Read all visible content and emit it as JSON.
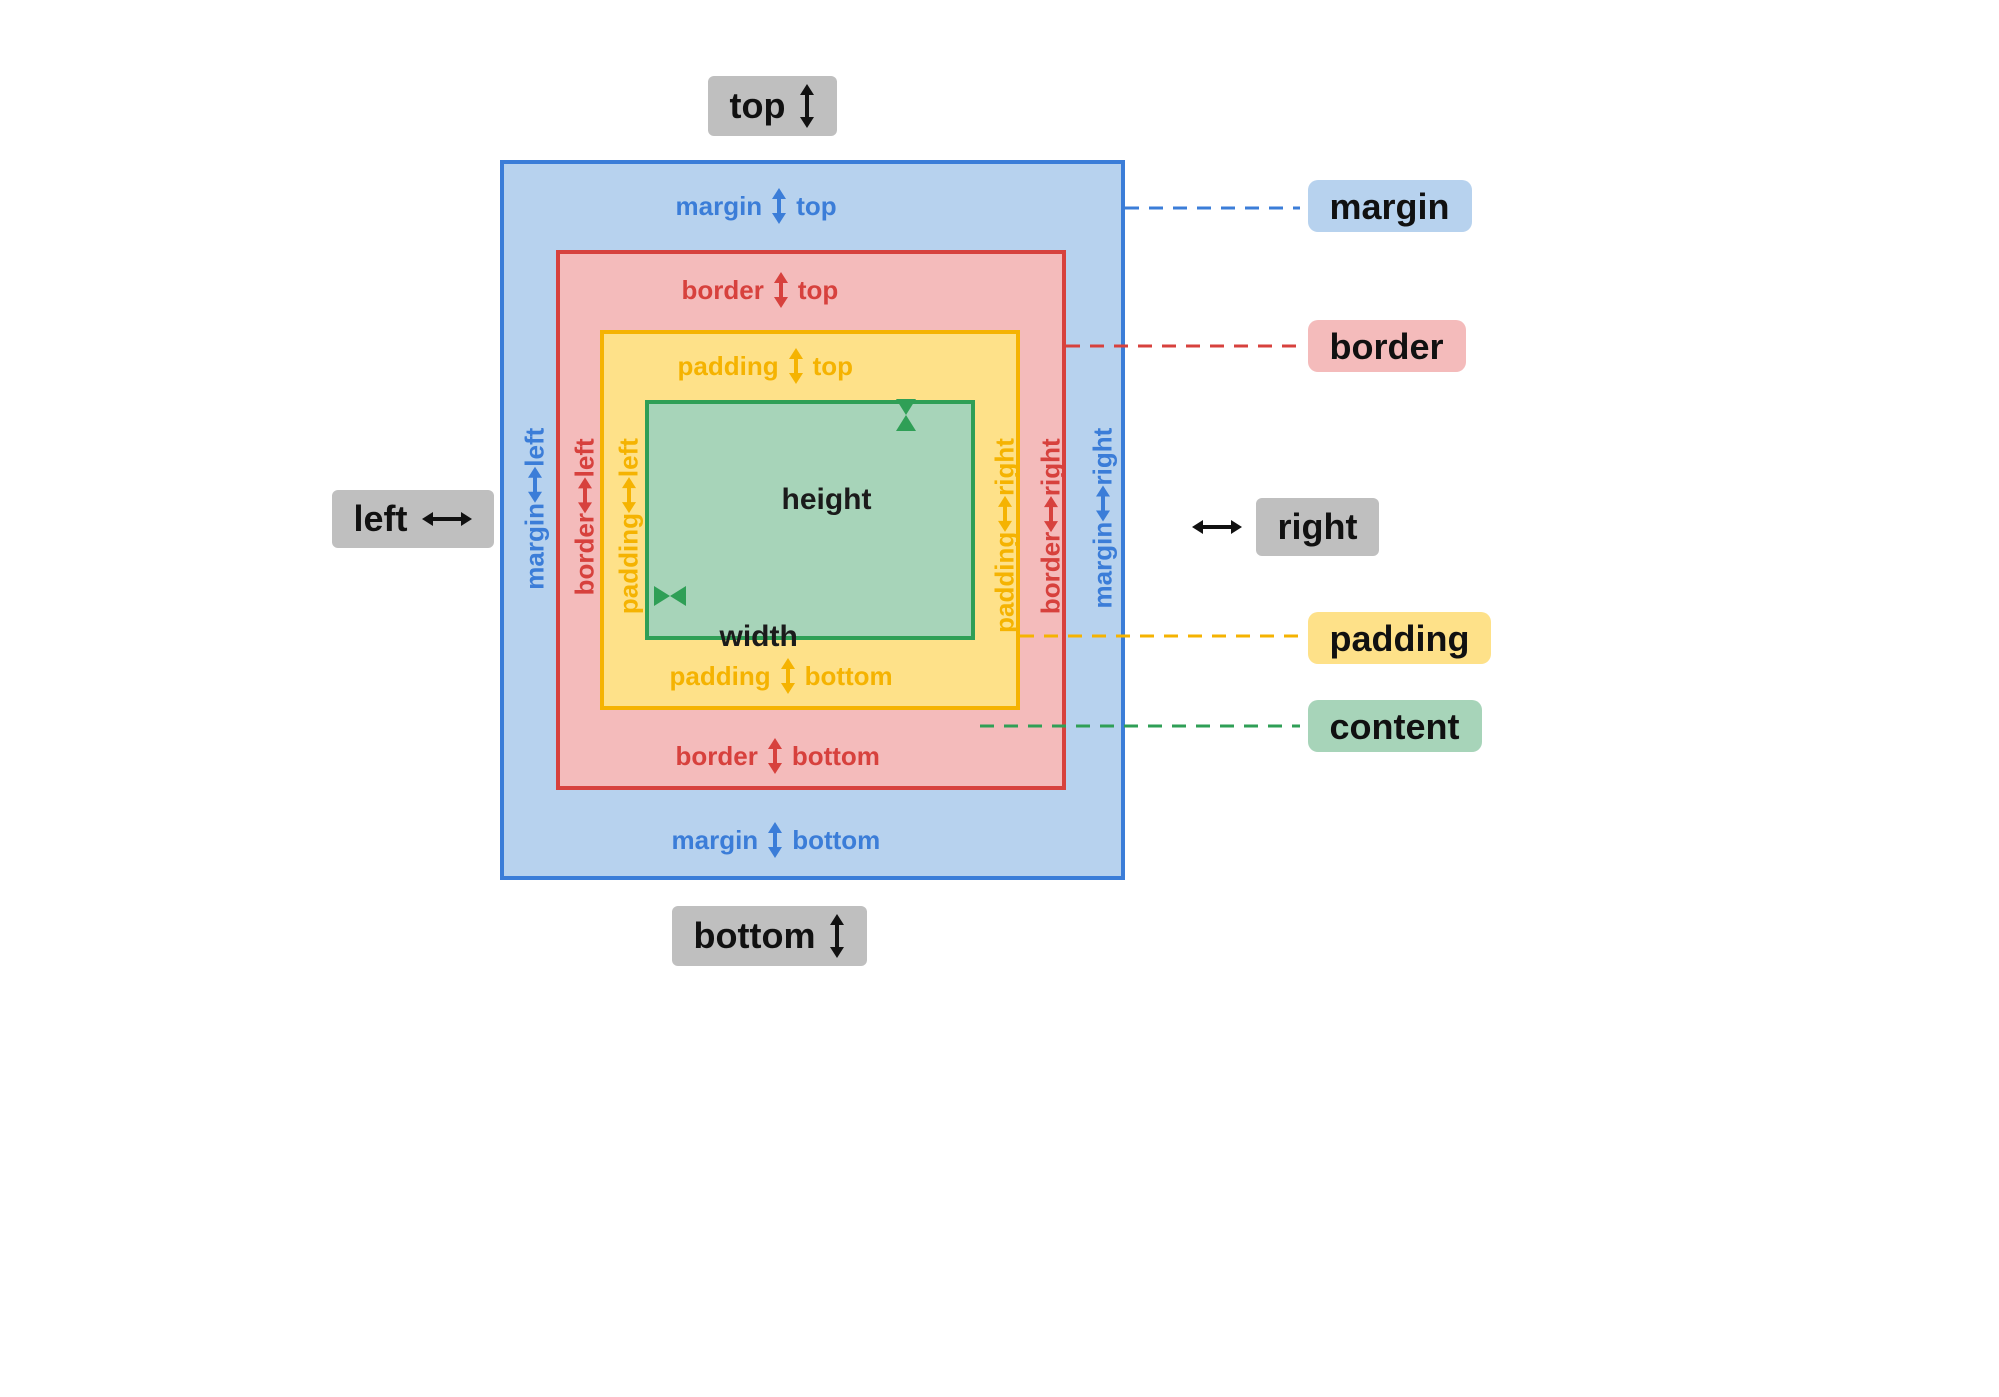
{
  "external": {
    "top": "top",
    "bottom": "bottom",
    "left": "left",
    "right": "right"
  },
  "margin": {
    "top_label": [
      "margin",
      "top"
    ],
    "bottom_label": [
      "margin",
      "bottom"
    ],
    "left_label": [
      "margin",
      "left"
    ],
    "right_label": [
      "margin",
      "right"
    ]
  },
  "border": {
    "top_label": [
      "border",
      "top"
    ],
    "bottom_label": [
      "border",
      "bottom"
    ],
    "left_label": [
      "border",
      "left"
    ],
    "right_label": [
      "border",
      "right"
    ]
  },
  "padding": {
    "top_label": [
      "padding",
      "top"
    ],
    "bottom_label": [
      "padding",
      "bottom"
    ],
    "left_label": [
      "padding",
      "left"
    ],
    "right_label": [
      "padding",
      "right"
    ]
  },
  "content": {
    "height": "height",
    "width": "width"
  },
  "legend": {
    "margin": "margin",
    "border": "border",
    "padding": "padding",
    "content": "content"
  },
  "colors": {
    "margin_fill": "#b7d2ee",
    "margin_stroke": "#3b7dd8",
    "border_fill": "#f4bbbb",
    "border_stroke": "#d7413d",
    "padding_fill": "#fee189",
    "padding_stroke": "#f5b301",
    "content_fill": "#a7d4b9",
    "content_stroke": "#2f9f56",
    "badge_fill": "#bfbfbf"
  }
}
